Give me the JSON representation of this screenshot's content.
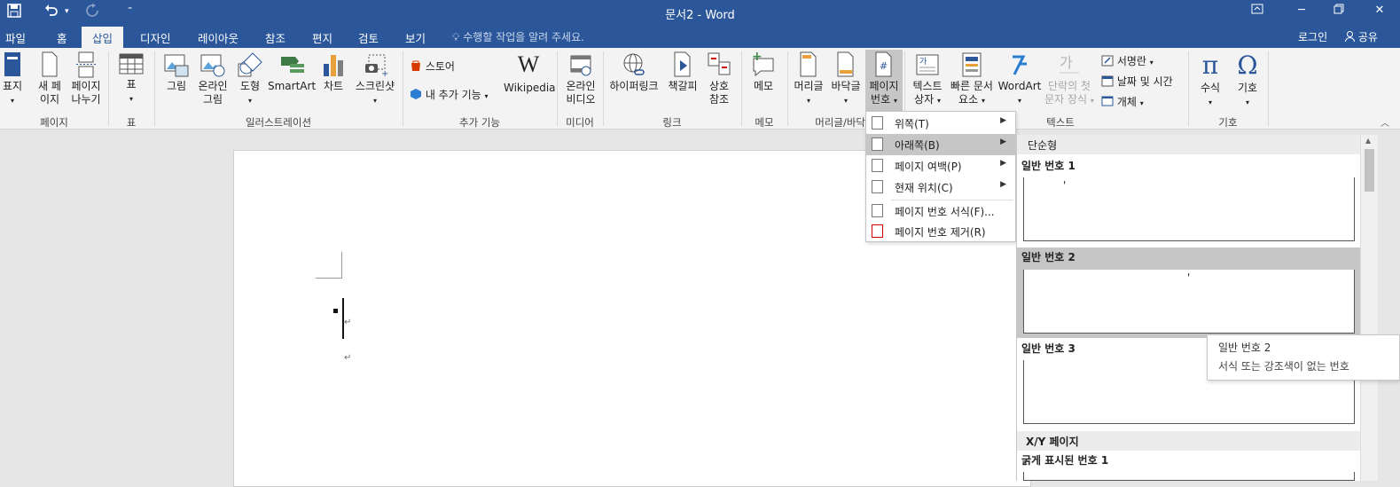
{
  "titlebar": {
    "title": "문서2 - Word",
    "save_icon": "save-icon",
    "undo_icon": "undo-icon",
    "redo_icon": "redo-icon"
  },
  "tabs": [
    "파일",
    "홈",
    "삽입",
    "디자인",
    "레이아웃",
    "참조",
    "편지",
    "검토",
    "보기"
  ],
  "tellme": "수행할 작업을 알려 주세요.",
  "login": "로그인",
  "share": "공유",
  "ribbon": {
    "cover": "표지",
    "blank1": "새 페",
    "blank2": "이지",
    "break1": "페이지",
    "break2": "나누기",
    "table": "표",
    "pictures": "그림",
    "online1": "온라인",
    "online2": "그림",
    "shapes": "도형",
    "smartart": "SmartArt",
    "chart": "차트",
    "screenshot": "스크린샷",
    "store": "스토어",
    "myaddins": "내 추가 기능",
    "wikipedia": "Wikipedia",
    "video1": "온라인",
    "video2": "비디오",
    "hyperlink": "하이퍼링크",
    "bookmark": "책갈피",
    "xref1": "상호",
    "xref2": "참조",
    "comment": "메모",
    "header": "머리글",
    "footer": "바닥글",
    "pagenum1": "페이지",
    "pagenum2": "번호",
    "textbox1": "텍스트",
    "textbox2": "상자",
    "quickparts1": "빠른 문서",
    "quickparts2": "요소",
    "wordart": "WordArt",
    "dropcap1": "단락의 첫",
    "dropcap2": "문자 장식",
    "signature": "서명란",
    "datetime": "날짜 및 시간",
    "object": "개체",
    "equation": "수식",
    "symbol": "기호",
    "groups": {
      "pages": "페이지",
      "tables": "표",
      "illustrations": "일러스트레이션",
      "addins": "추가 기능",
      "media": "미디어",
      "links": "링크",
      "comments": "메모",
      "headerfooter": "머리글/바닥",
      "text": "텍스트",
      "symbols": "기호"
    }
  },
  "menu": {
    "items": [
      {
        "label": "위쪽(T)",
        "arrow": "▶"
      },
      {
        "label": "아래쪽(B)",
        "arrow": "▶"
      },
      {
        "label": "페이지 여백(P)",
        "arrow": "▶"
      },
      {
        "label": "현재 위치(C)",
        "arrow": "▶"
      },
      {
        "label": "페이지 번호 서식(F)..."
      },
      {
        "label": "페이지 번호 제거(R)"
      }
    ]
  },
  "gallery": {
    "header1": "단순형",
    "item1": "일반 번호 1",
    "item2": "일반 번호 2",
    "item3": "일반 번호 3",
    "header2": "X/Y 페이지",
    "item4": "굵게 표시된 번호 1",
    "number_glyph": "'"
  },
  "tooltip": {
    "title": "일반 번호 2",
    "desc": "서식 또는 강조색이 없는 번호"
  },
  "document": {
    "para_mark": "↵"
  }
}
